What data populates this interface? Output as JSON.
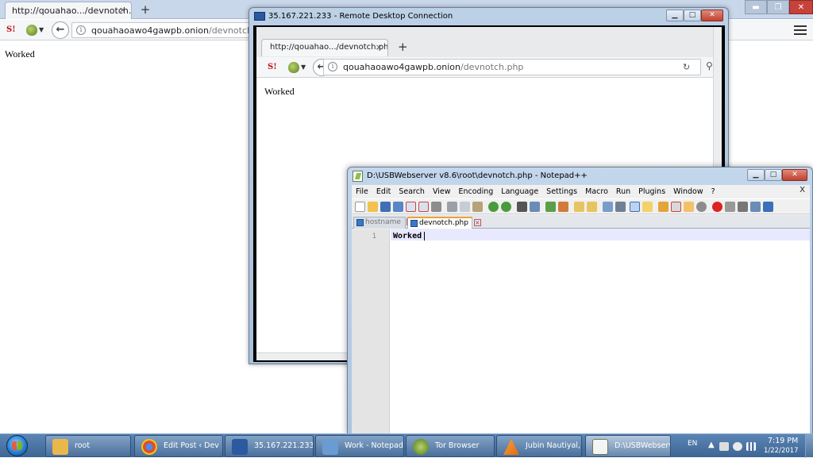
{
  "bg_browser": {
    "tab_title": "http://qouahao.../devnotch.php",
    "url_host": "qouahaoawo4gawpb.onion",
    "url_path": "/devnotch.php",
    "page_text": "Worked",
    "badge": "S!",
    "new_tab": "+",
    "close_glyph": "×"
  },
  "rdp": {
    "title": "35.167.221.233 - Remote Desktop Connection",
    "inner_browser": {
      "tab_title": "http://qouahao.../devnotch.php",
      "url_host": "qouahaoawo4gawpb.onion",
      "url_path": "/devnotch.php",
      "page_text": "Worked",
      "badge": "S!",
      "new_tab": "+"
    }
  },
  "notepad": {
    "title": "D:\\USBWebserver v8.6\\root\\devnotch.php - Notepad++",
    "menu": [
      "File",
      "Edit",
      "Search",
      "View",
      "Encoding",
      "Language",
      "Settings",
      "Macro",
      "Run",
      "Plugins",
      "Window",
      "?"
    ],
    "menu_close": "X",
    "tabs": [
      {
        "label": "hostname",
        "active": false
      },
      {
        "label": "devnotch.php",
        "active": true
      }
    ],
    "line_number": "1",
    "code": "Worked"
  },
  "taskbar": {
    "items": [
      {
        "label": "root",
        "color": "#e8b84a"
      },
      {
        "label": "Edit Post ‹ Dev ...",
        "color": "#e04b35"
      },
      {
        "label": "35.167.221.233 -...",
        "color": "#2c5aa0"
      },
      {
        "label": "Work - Notepad",
        "color": "#6a9bd1"
      },
      {
        "label": "Tor Browser",
        "color": "#7eb848"
      },
      {
        "label": "Jubin Nautiyal, ...",
        "color": "#f08a1c"
      },
      {
        "label": "D:\\USBWebserv...",
        "color": "#8bc34a"
      }
    ],
    "language": "EN",
    "time": "7:19 PM",
    "date": "1/22/2017"
  },
  "colors": {
    "title_bar": "#bcd0e6",
    "taskbar": "#3e6694",
    "close_button": "#c7423a"
  }
}
